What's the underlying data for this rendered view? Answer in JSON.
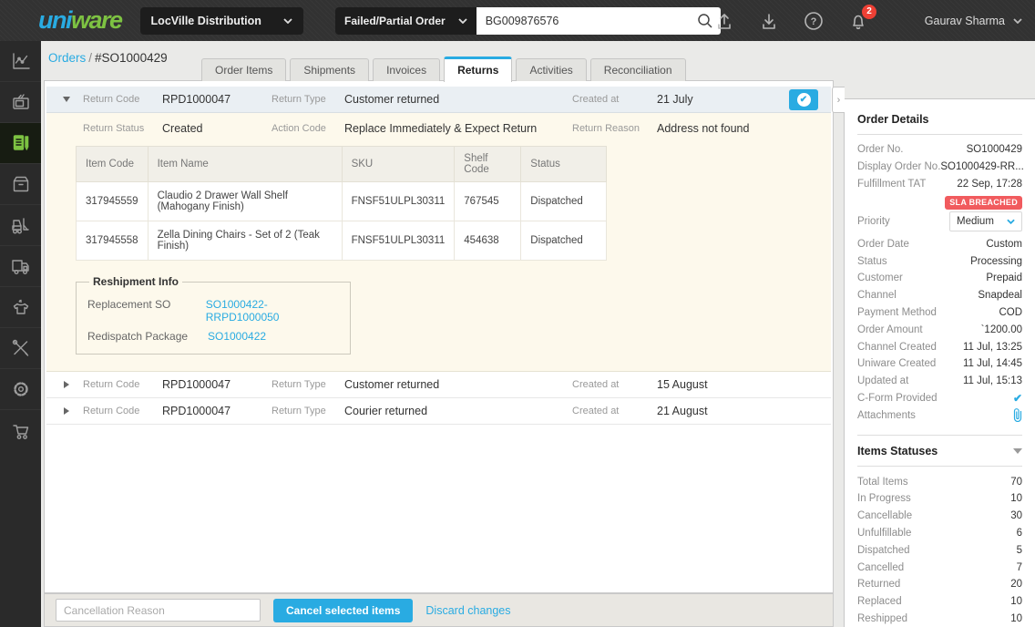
{
  "colors": {
    "accent_blue": "#29abe2",
    "brand_green": "#7dc242",
    "sla_red": "#f15b5e",
    "notification_red": "#ee4035"
  },
  "topbar": {
    "logo_uni": "uni",
    "logo_ware": "ware",
    "facility": "LocVille Distribution",
    "search_type": "Failed/Partial Order",
    "search_value": "BG009876576",
    "notification_count": "2",
    "user_name": "Gaurav Sharma"
  },
  "sidebar": {
    "active": "orders",
    "items": [
      "analytics",
      "channels",
      "orders",
      "inventory",
      "fulfillment",
      "dispatch",
      "catalog",
      "tools",
      "settings",
      "purchase-cart"
    ]
  },
  "breadcrumb": {
    "parent": "Orders",
    "separator": "/",
    "current": "#SO1000429"
  },
  "tabs": [
    {
      "label": "Order Items"
    },
    {
      "label": "Shipments"
    },
    {
      "label": "Invoices"
    },
    {
      "label": "Returns"
    },
    {
      "label": "Activities"
    },
    {
      "label": "Reconciliation"
    }
  ],
  "returns": {
    "labels": {
      "return_code": "Return Code",
      "return_type": "Return Type",
      "created_at": "Created at",
      "return_status": "Return Status",
      "action_code": "Action Code",
      "return_reason": "Return Reason"
    },
    "entries": [
      {
        "code": "RPD1000047",
        "type": "Customer returned",
        "created": "21 July",
        "status": "Created",
        "action_code": "Replace Immediately & Expect Return",
        "reason": "Address not found"
      },
      {
        "code": "RPD1000047",
        "type": "Customer returned",
        "created": "15 August"
      },
      {
        "code": "RPD1000047",
        "type": "Courier returned",
        "created": "21 August"
      }
    ],
    "items_table": {
      "headers": [
        "Item Code",
        "Item Name",
        "SKU",
        "Shelf Code",
        "Status"
      ],
      "rows": [
        [
          "317945559",
          "Claudio 2 Drawer Wall Shelf (Mahogany Finish)",
          "FNSF51ULPL30311",
          "767545",
          "Dispatched"
        ],
        [
          "317945558",
          "Zella Dining Chairs - Set of 2 (Teak Finish)",
          "FNSF51ULPL30311",
          "454638",
          "Dispatched"
        ]
      ]
    },
    "reshipment": {
      "title": "Reshipment Info",
      "replacement_so_label": "Replacement SO",
      "replacement_so": "SO1000422-RRPD1000050",
      "redispatch_package_label": "Redispatch Package",
      "redispatch_package": "SO1000422"
    }
  },
  "footer": {
    "placeholder": "Cancellation Reason",
    "cancel_button": "Cancel selected items",
    "discard_link": "Discard changes"
  },
  "order_details": {
    "title": "Order Details",
    "order_no": {
      "label": "Order No.",
      "value": "SO1000429"
    },
    "display_order_no": {
      "label": "Display Order No.",
      "value": "SO1000429-RR..."
    },
    "fulfillment_tat": {
      "label": "Fulfillment TAT",
      "value": "22 Sep, 17:28",
      "badge": "SLA BREACHED"
    },
    "priority": {
      "label": "Priority",
      "value": "Medium"
    },
    "rows": [
      {
        "label": "Order Date",
        "value": "Custom"
      },
      {
        "label": "Status",
        "value": "Processing"
      },
      {
        "label": "Customer",
        "value": "Prepaid"
      },
      {
        "label": "Channel",
        "value": "Snapdeal"
      },
      {
        "label": "Payment Method",
        "value": "COD"
      },
      {
        "label": "Order Amount",
        "value": "`1200.00"
      },
      {
        "label": "Channel Created",
        "value": "11 Jul, 13:25"
      },
      {
        "label": "Uniware Created",
        "value": "11 Jul, 14:45"
      },
      {
        "label": "Updated at",
        "value": "11 Jul, 15:13"
      }
    ],
    "c_form_label": "C-Form Provided",
    "attachments_label": "Attachments"
  },
  "items_statuses": {
    "title": "Items Statuses",
    "rows": [
      {
        "label": "Total Items",
        "value": "70"
      },
      {
        "label": "In Progress",
        "value": "10"
      },
      {
        "label": "Cancellable",
        "value": "30"
      },
      {
        "label": "Unfulfillable",
        "value": "6"
      },
      {
        "label": "Dispatched",
        "value": "5"
      },
      {
        "label": "Cancelled",
        "value": "7"
      },
      {
        "label": "Returned",
        "value": "20"
      },
      {
        "label": "Replaced",
        "value": "10"
      },
      {
        "label": "Reshipped",
        "value": "10"
      }
    ]
  }
}
